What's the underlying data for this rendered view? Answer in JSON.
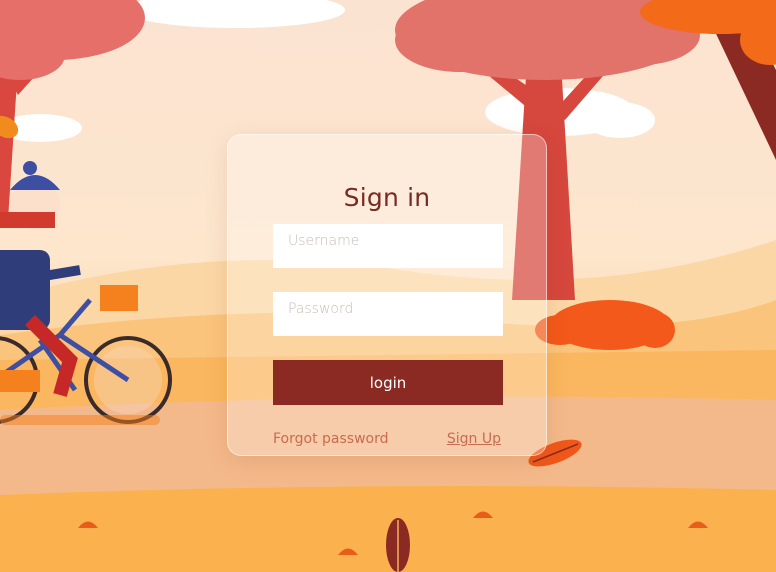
{
  "login": {
    "title": "Sign in",
    "username_placeholder": "Username",
    "password_placeholder": "Password",
    "login_label": "login",
    "forgot_label": "Forgot password",
    "signup_label": "Sign Up"
  },
  "colors": {
    "accent": "#8b2a22",
    "title": "#7a2a22",
    "link": "#c96b4e",
    "sky": "#fde7cf",
    "ground": "#fbb657"
  },
  "icons": [
    "tree",
    "leaf",
    "cloud",
    "bush",
    "cyclist"
  ]
}
